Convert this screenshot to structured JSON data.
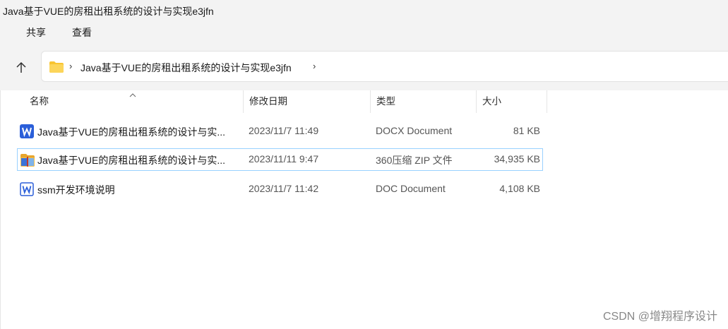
{
  "window": {
    "title": "Java基于VUE的房租出租系统的设计与实现e3jfn"
  },
  "ribbon": {
    "tabs": [
      {
        "label": "共享"
      },
      {
        "label": "查看"
      }
    ]
  },
  "address": {
    "path": "Java基于VUE的房租出租系统的设计与实现e3jfn"
  },
  "columns": {
    "name": "名称",
    "date": "修改日期",
    "type": "类型",
    "size": "大小"
  },
  "files": [
    {
      "name": "Java基于VUE的房租出租系统的设计与实...",
      "date": "2023/11/7 11:49",
      "type": "DOCX Document",
      "size": "81 KB",
      "icon": "word-docx-icon"
    },
    {
      "name": "Java基于VUE的房租出租系统的设计与实...",
      "date": "2023/11/11 9:47",
      "type": "360压缩 ZIP 文件",
      "size": "34,935 KB",
      "icon": "zip-archive-icon"
    },
    {
      "name": "ssm开发环境说明",
      "date": "2023/11/7 11:42",
      "type": "DOC Document",
      "size": "4,108 KB",
      "icon": "word-doc-icon"
    }
  ],
  "watermark": "CSDN @增翔程序设计",
  "colors": {
    "selection_border": "#99d1ff",
    "word_blue": "#2b5fd9",
    "folder_yellow": "#f8c431"
  }
}
